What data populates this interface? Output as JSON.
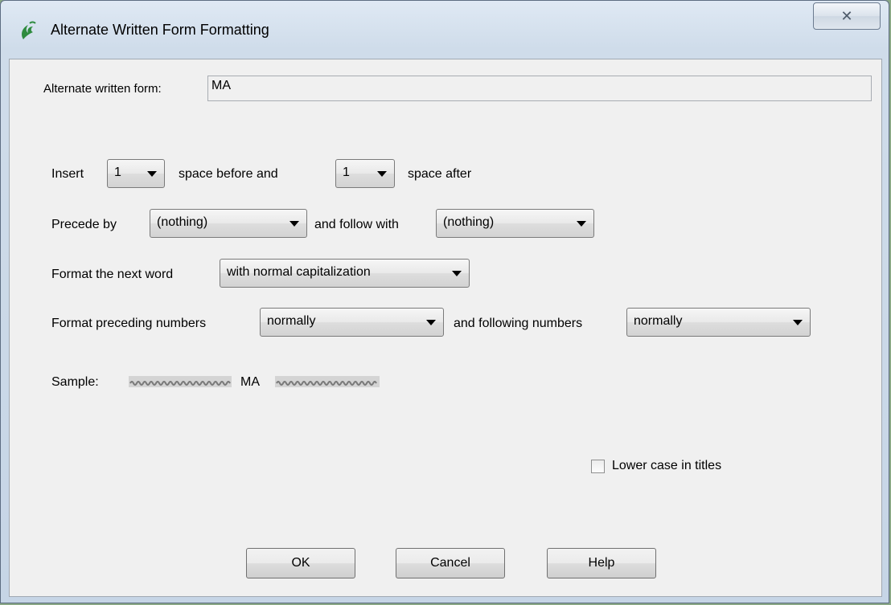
{
  "window": {
    "title": "Alternate Written Form Formatting",
    "close_symbol": "✕"
  },
  "form": {
    "alt_form_label": "Alternate written form:",
    "alt_form_value": "MA",
    "insert_label": "Insert",
    "space_before_value": "1",
    "space_before_label": "space before and",
    "space_after_value": "1",
    "space_after_label": "space after",
    "precede_label": "Precede by",
    "precede_value": "(nothing)",
    "follow_label": "and follow with",
    "follow_value": "(nothing)",
    "next_word_label": "Format the next word",
    "next_word_value": "with normal capitalization",
    "preceding_numbers_label": "Format preceding numbers",
    "preceding_numbers_value": "normally",
    "following_numbers_label": "and following numbers",
    "following_numbers_value": "normally",
    "sample_label": "Sample:",
    "sample_text": "MA",
    "lowercase_titles_label": "Lower case in titles",
    "lowercase_titles_checked": false
  },
  "buttons": {
    "ok": "OK",
    "cancel": "Cancel",
    "help": "Help"
  },
  "colors": {
    "accent_icon": "#2e8b3e",
    "dialog_bg": "#f0f0f0"
  }
}
